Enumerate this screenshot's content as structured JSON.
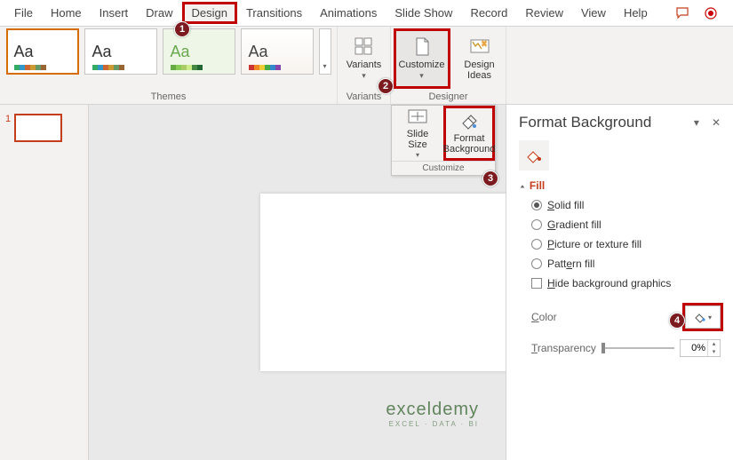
{
  "tabs": {
    "file": "File",
    "home": "Home",
    "insert": "Insert",
    "draw": "Draw",
    "design": "Design",
    "transitions": "Transitions",
    "animations": "Animations",
    "slideshow": "Slide Show",
    "record": "Record",
    "review": "Review",
    "view": "View",
    "help": "Help"
  },
  "ribbon": {
    "themes_label": "Themes",
    "variants_label": "Variants",
    "variants_btn": "Variants",
    "customize_btn": "Customize",
    "design_ideas_label": "Designer",
    "design_ideas_btn": "Design\nIdeas",
    "theme_thumbs": [
      {
        "aa": "Aa",
        "color": "#333"
      },
      {
        "aa": "Aa",
        "color": "#333"
      },
      {
        "aa": "Aa",
        "color": "#6aa84f"
      },
      {
        "aa": "Aa",
        "color": "#444"
      }
    ]
  },
  "customize_popup": {
    "slide_size": "Slide\nSize",
    "format_bg": "Format\nBackground",
    "footer": "Customize"
  },
  "thumbs_panel": {
    "slide_number": "1"
  },
  "pane": {
    "title": "Format Background",
    "section": "Fill",
    "opts": {
      "solid": "Solid fill",
      "gradient": "Gradient fill",
      "picture": "Picture or texture fill",
      "pattern": "Pattern fill",
      "hide": "Hide background graphics"
    },
    "color_label": "Color",
    "transparency_label": "Transparency",
    "transparency_value": "0%"
  },
  "badges": {
    "b1": "1",
    "b2": "2",
    "b3": "3",
    "b4": "4"
  },
  "watermark": {
    "line1": "exceldemy",
    "line2": "EXCEL · DATA · BI"
  }
}
